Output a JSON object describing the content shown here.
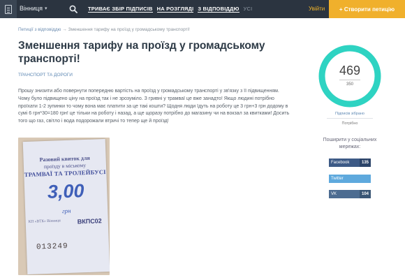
{
  "header": {
    "city": "Вінниця",
    "nav": [
      {
        "label": "Триває збір підписів",
        "dim": false
      },
      {
        "label": "На розгляді",
        "dim": false
      },
      {
        "label": "З відповіддю",
        "dim": false
      },
      {
        "label": "Усі",
        "dim": true
      }
    ],
    "login_label": "Увійти",
    "create_label": "+ Створити петицію"
  },
  "breadcrumb": {
    "parent": "Петиції з відповіддю",
    "separator": "→",
    "current": "Зменшення тарифу на проїзд у громадському транспорті!"
  },
  "petition": {
    "title": "Зменшення тарифу на проїзд у громадському транспорті!",
    "category": "Транспорт та дороги",
    "body": "Прошу знизити або повернути попередню вартість на проїзд у громадському транспорті у зв'язку з її підвищенням. Чому було підвищено ціну на проїзд так і не зрозуміло. З гривні у трамваї це вже занадто! Якщо людині потрібно проїхати 1-2 зупинки то чому вона має платити за це такі кошти? Щодня люди їдуть на роботу це 3 грн+3 грн додому в сумі 6 грн*30=180 грн! це тільки на роботу і назад, а ще щоразу потрібно до магазину чи на вокзал за квитками! Досить того що газ, світло і вода подорожали втричі то тепер ще й проїзд!"
  },
  "ticket": {
    "line1": "Разовий квиток для",
    "line2": "проїзду в міському",
    "line3": "ТРАМВАЇ ТА ТРОЛЕЙБУСІ",
    "price": "3,00",
    "unit": "грн",
    "small": "КП «ВТК» Вінниця",
    "series": "ВКПС02",
    "number": "013249"
  },
  "stats": {
    "signatures": "469",
    "goal": "350",
    "progress": 1.0,
    "collected_label": "Підписів зібрано",
    "needed_label": "Потрібно",
    "ring_color": "#2ed3c2"
  },
  "share": {
    "title": "Поширити у соціальних мережах:",
    "buttons": [
      {
        "label": "Facebook",
        "count": "135"
      },
      {
        "label": "Twitter",
        "count": ""
      },
      {
        "label": "VK",
        "count": "104"
      }
    ]
  }
}
